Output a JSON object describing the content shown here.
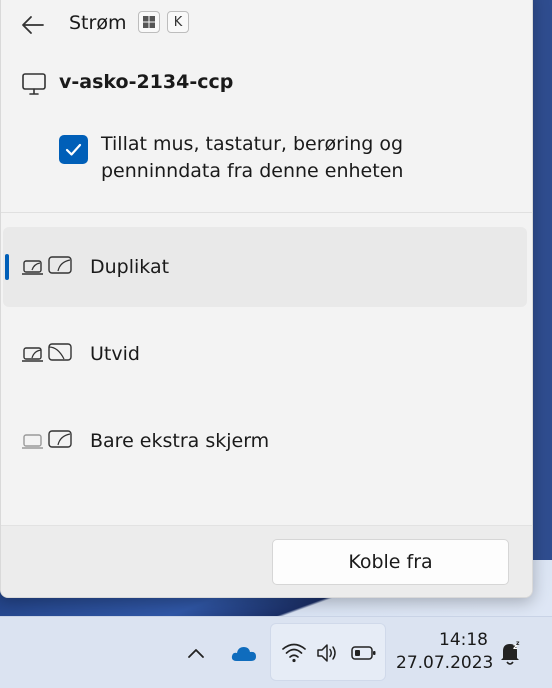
{
  "panel": {
    "title": "Strøm",
    "shortcut_keys": [
      "⊞",
      "K"
    ],
    "device_name": "v-asko-2134-ccp",
    "input_permission": {
      "checked": true,
      "label": "Tillat mus, tastatur, berøring og penninndata fra denne enheten"
    },
    "projection_options": [
      {
        "label": "Duplikat",
        "selected": true,
        "icon": "duplicate-display-icon"
      },
      {
        "label": "Utvid",
        "selected": false,
        "icon": "extend-display-icon"
      },
      {
        "label": "Bare ekstra skjerm",
        "selected": false,
        "icon": "second-screen-only-icon"
      }
    ],
    "disconnect_label": "Koble fra"
  },
  "taskbar": {
    "time": "14:18",
    "date": "27.07.2023"
  },
  "colors": {
    "accent": "#005fb8",
    "panel_bg": "#f3f3f3",
    "taskbar_bg": "#dbe3f1"
  }
}
